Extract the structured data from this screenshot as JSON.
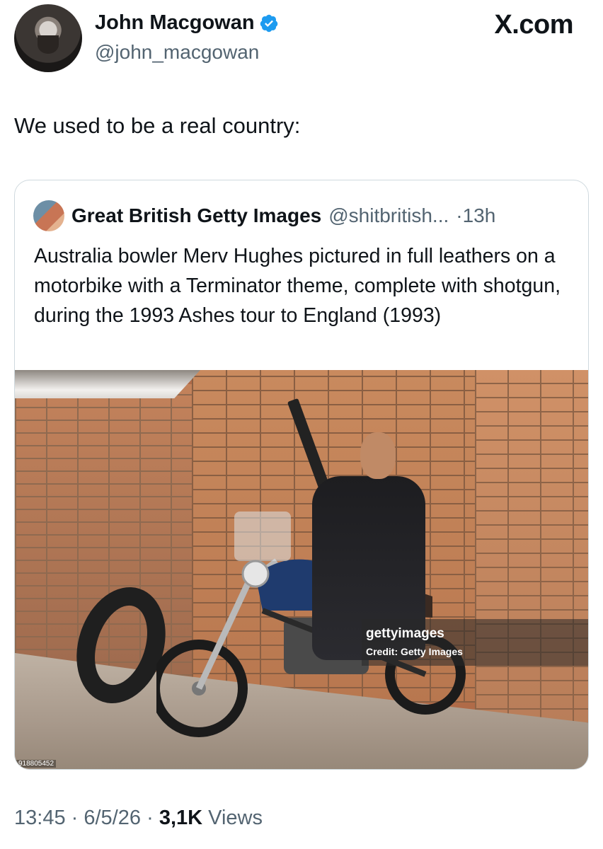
{
  "author": {
    "name": "John Macgowan",
    "handle": "@john_macgowan"
  },
  "brand": "X.com",
  "tweet_text": "We used to be a real country:",
  "quoted": {
    "name": "Great British Getty Images",
    "handle": "@shitbritish...",
    "separator": "·",
    "time": "13h",
    "text": "Australia bowler Merv Hughes pictured in full leathers on a motorbike with a Terminator theme, complete with shotgun, during the 1993 Ashes tour to England (1993)",
    "image": {
      "watermark_logo": "gettyimages",
      "watermark_credit": "Credit: Getty Images",
      "image_id": "918805452"
    }
  },
  "meta": {
    "time": "13:45",
    "sep1": "·",
    "date": "6/5/26",
    "sep2": "·",
    "views_count": "3,1K",
    "views_label": "Views"
  },
  "colors": {
    "verified": "#1d9bf0",
    "text": "#0f1419",
    "secondary": "#536471",
    "border": "#cfd9de"
  }
}
